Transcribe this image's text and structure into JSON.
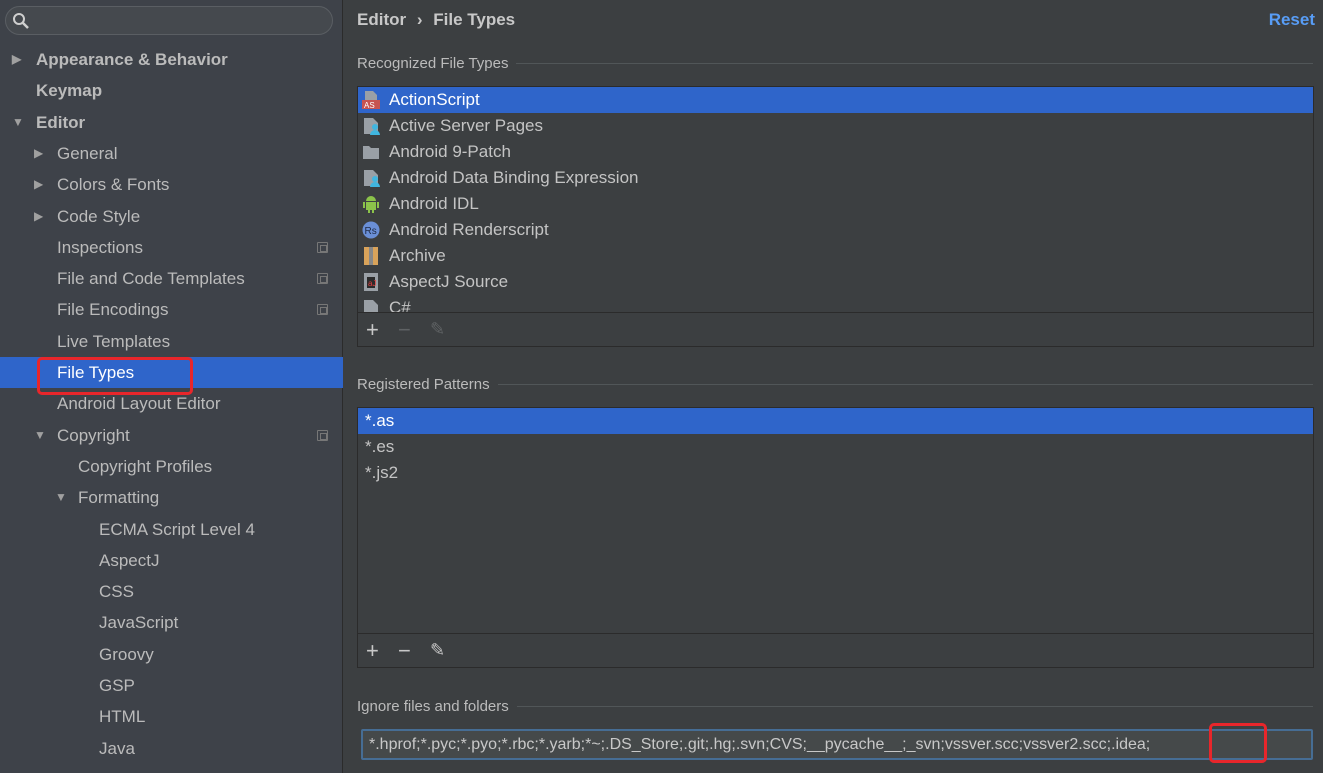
{
  "search": {
    "placeholder": "",
    "icon": "search-icon"
  },
  "sidebar": {
    "items": [
      {
        "label": "Appearance & Behavior",
        "level": 0,
        "arrow": "right",
        "bold": true
      },
      {
        "label": "Keymap",
        "level": 0,
        "bold": true
      },
      {
        "label": "Editor",
        "level": 0,
        "arrow": "down",
        "bold": true
      },
      {
        "label": "General",
        "level": 1,
        "arrow": "right"
      },
      {
        "label": "Colors & Fonts",
        "level": 1,
        "arrow": "right"
      },
      {
        "label": "Code Style",
        "level": 1,
        "arrow": "right"
      },
      {
        "label": "Inspections",
        "level": 1,
        "copy": true
      },
      {
        "label": "File and Code Templates",
        "level": 1,
        "copy": true
      },
      {
        "label": "File Encodings",
        "level": 1,
        "copy": true
      },
      {
        "label": "Live Templates",
        "level": 1
      },
      {
        "label": "File Types",
        "level": 1,
        "selected": true
      },
      {
        "label": "Android Layout Editor",
        "level": 1
      },
      {
        "label": "Copyright",
        "level": 1,
        "arrow": "down",
        "copy": true
      },
      {
        "label": "Copyright Profiles",
        "level": 2
      },
      {
        "label": "Formatting",
        "level": 2,
        "arrow": "down"
      },
      {
        "label": "ECMA Script Level 4",
        "level": 3
      },
      {
        "label": "AspectJ",
        "level": 3
      },
      {
        "label": "CSS",
        "level": 3
      },
      {
        "label": "JavaScript",
        "level": 3
      },
      {
        "label": "Groovy",
        "level": 3
      },
      {
        "label": "GSP",
        "level": 3
      },
      {
        "label": "HTML",
        "level": 3
      },
      {
        "label": "Java",
        "level": 3
      }
    ]
  },
  "header": {
    "breadcrumb_parent": "Editor",
    "separator": "›",
    "breadcrumb_current": "File Types",
    "reset_label": "Reset"
  },
  "recognized": {
    "label": "Recognized File Types",
    "items": [
      {
        "label": "ActionScript",
        "icon": "actionscript-icon",
        "selected": true
      },
      {
        "label": "Active Server Pages",
        "icon": "file-user-icon"
      },
      {
        "label": "Android 9-Patch",
        "icon": "folder-icon"
      },
      {
        "label": "Android Data Binding Expression",
        "icon": "file-user-icon"
      },
      {
        "label": "Android IDL",
        "icon": "android-icon"
      },
      {
        "label": "Android Renderscript",
        "icon": "renderscript-icon"
      },
      {
        "label": "Archive",
        "icon": "archive-icon"
      },
      {
        "label": "AspectJ Source",
        "icon": "aspectj-icon"
      },
      {
        "label": "C#",
        "icon": "file-icon"
      }
    ]
  },
  "patterns": {
    "label": "Registered Patterns",
    "items": [
      {
        "label": "*.as",
        "selected": true
      },
      {
        "label": "*.es"
      },
      {
        "label": "*.js2"
      }
    ]
  },
  "ignore": {
    "label": "Ignore files and folders",
    "value": "*.hprof;*.pyc;*.pyo;*.rbc;*.yarb;*~;.DS_Store;.git;.hg;.svn;CVS;__pycache__;_svn;vssver.scc;vssver2.scc;.idea;"
  },
  "toolbar": {
    "add": "+",
    "remove": "−",
    "edit": "✎"
  },
  "colors": {
    "selection": "#2f65ca",
    "highlight": "#e8262b",
    "link": "#589df6"
  }
}
